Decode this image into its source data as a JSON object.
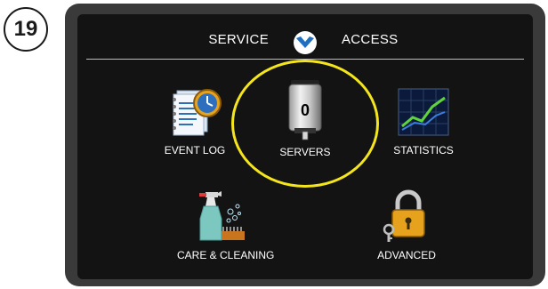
{
  "step": {
    "number": "19"
  },
  "header": {
    "left_text": "SERVICE",
    "right_text": "ACCESS"
  },
  "menu": {
    "event_log": {
      "label": "EVENT LOG",
      "icon": "event-log-icon"
    },
    "servers": {
      "label": "SERVERS",
      "icon": "server-icon",
      "count": "0",
      "highlighted": true
    },
    "statistics": {
      "label": "STATISTICS",
      "icon": "statistics-chart-icon"
    },
    "care_cleaning": {
      "label": "CARE & CLEANING",
      "icon": "cleaning-spray-icon"
    },
    "advanced": {
      "label": "ADVANCED",
      "icon": "padlock-key-icon"
    }
  },
  "colors": {
    "highlight": "#f4e51d",
    "screen_background": "#131313",
    "bezel": "#3a3a3a",
    "logo_blue": "#1f6fc1"
  }
}
